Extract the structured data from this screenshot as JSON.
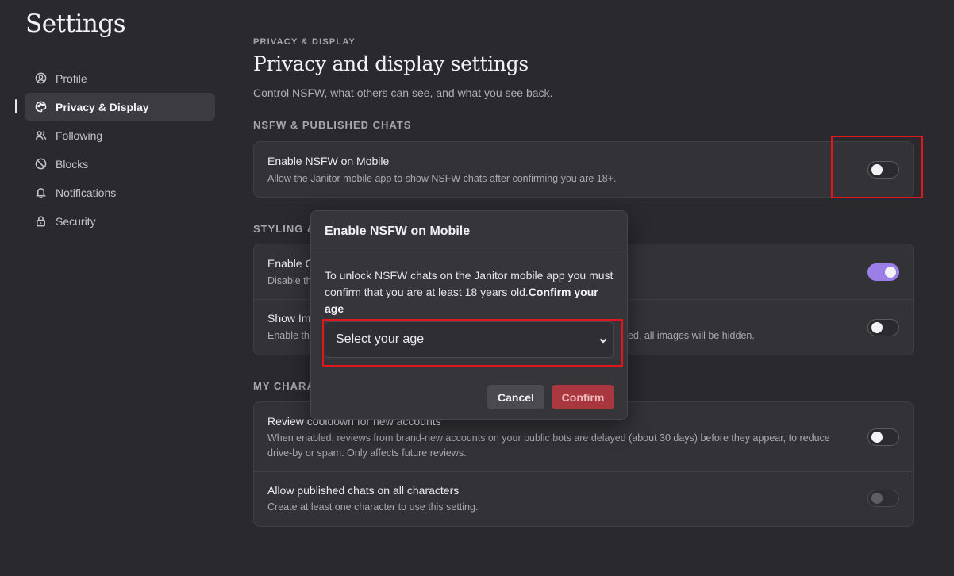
{
  "sidebar": {
    "title": "Settings",
    "items": [
      {
        "label": "Profile",
        "icon": "user-circle-icon"
      },
      {
        "label": "Privacy & Display",
        "icon": "palette-icon"
      },
      {
        "label": "Following",
        "icon": "users-icon"
      },
      {
        "label": "Blocks",
        "icon": "block-icon"
      },
      {
        "label": "Notifications",
        "icon": "bell-icon"
      },
      {
        "label": "Security",
        "icon": "lock-icon"
      }
    ],
    "active_index": 1
  },
  "main": {
    "eyebrow": "PRIVACY & DISPLAY",
    "title": "Privacy and display settings",
    "subtitle": "Control NSFW, what others can see, and what you see back.",
    "sections": [
      {
        "heading": "NSFW & PUBLISHED CHATS",
        "rows": [
          {
            "title": "Enable NSFW on Mobile",
            "desc": "Allow the Janitor mobile app to show NSFW chats after confirming you are 18+.",
            "toggle": false
          }
        ]
      },
      {
        "heading": "STYLING &",
        "rows": [
          {
            "title": "Enable C",
            "desc": "Disable th",
            "toggle": true
          },
          {
            "title": "Show Im",
            "desc_left": "Enable thi",
            "desc_right": "ed, all images will be hidden.",
            "toggle": false
          }
        ]
      },
      {
        "heading": "MY CHARA",
        "rows": [
          {
            "title": "Review cooldown for new accounts",
            "desc": "When enabled, reviews from brand-new accounts on your public bots are delayed (about 30 days) before they appear, to reduce drive-by or spam. Only affects future reviews.",
            "toggle": false
          },
          {
            "title": "Allow published chats on all characters",
            "desc": "Create at least one character to use this setting.",
            "toggle": false,
            "disabled": true
          }
        ]
      }
    ]
  },
  "modal": {
    "title": "Enable NSFW on Mobile",
    "body": "To unlock NSFW chats on the Janitor mobile app you must confirm that you are at least 18 years old.",
    "body_bold": "Confirm your age",
    "select_placeholder": "Select your age",
    "cancel_label": "Cancel",
    "confirm_label": "Confirm"
  },
  "colors": {
    "background": "#2a2a2e",
    "card": "#333337",
    "toggle_on": "#9b7ee8",
    "confirm_button": "#a8373f",
    "highlight": "#e0181e"
  }
}
